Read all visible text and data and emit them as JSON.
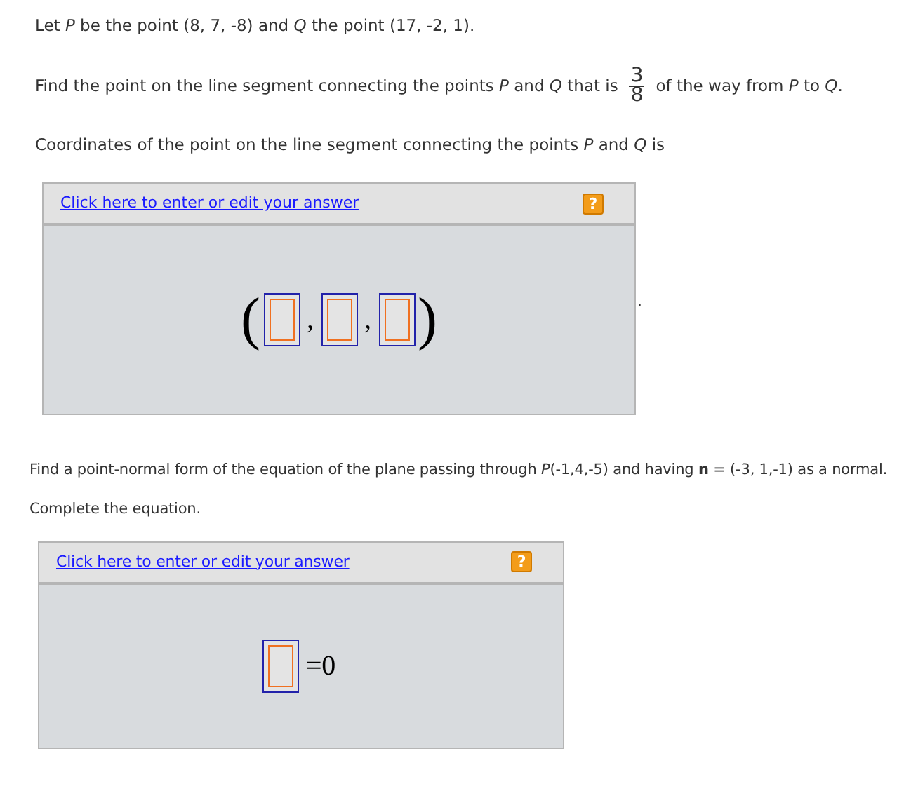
{
  "problem_1": {
    "statement": "Let *P* be the point (8, 7, -8) and *Q* the point (17, -2, 1).",
    "question": {
      "before": "Find the point on the line segment connecting the points *P* and *Q* that is",
      "numerator": "3",
      "denominator": "8",
      "after": "of the way from *P* to *Q*."
    },
    "prompt": "Coordinates of the point on the line segment connecting the points *P* and *Q* is",
    "answer_panel": {
      "link": "Click here to enter or edit your answer",
      "help": "?",
      "math": [
        {
          "kind": "paren",
          "text": "("
        },
        {
          "kind": "blank"
        },
        {
          "kind": "text",
          "text": ","
        },
        {
          "kind": "blank"
        },
        {
          "kind": "text",
          "text": ","
        },
        {
          "kind": "blank"
        },
        {
          "kind": "paren",
          "text": ")"
        }
      ]
    },
    "trailing_mark": "."
  },
  "problem_2": {
    "statement": "Find a point-normal form of the equation of the plane passing through *P*(-1,4,-5) and having **n** = (-3, 1,-1) as a normal.",
    "prompt": "Complete the equation.",
    "answer_panel": {
      "link": "Click here to enter or edit your answer",
      "help": "?",
      "math": [
        {
          "kind": "blank"
        },
        {
          "kind": "text",
          "text": "=0"
        }
      ]
    }
  }
}
